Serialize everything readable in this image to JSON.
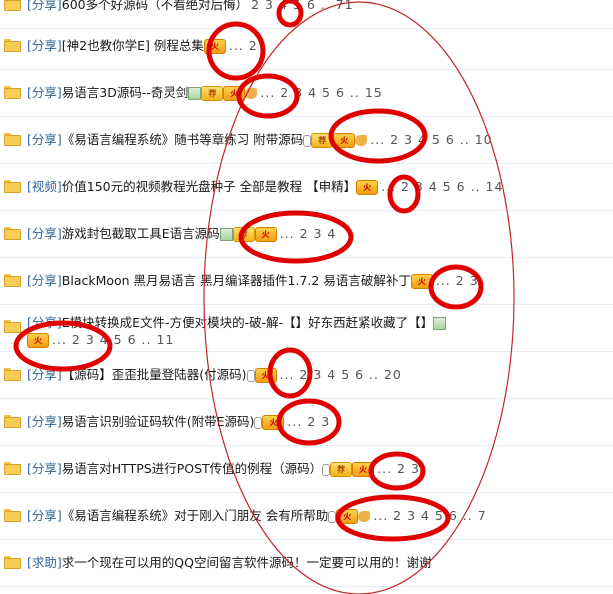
{
  "rows": [
    {
      "tag": "[分享]",
      "title": "600多个好源码（不看绝对后悔）",
      "icons": [],
      "pages": "2  3  4  5  6 .. 71"
    },
    {
      "tag": "[分享]",
      "title": "[神2也教你学E] 例程总集",
      "icons": [
        "fire"
      ],
      "pages": "... 2"
    },
    {
      "tag": "[分享]",
      "title": "易语言3D源码--奇灵剑",
      "icons": [
        "pic",
        "jian",
        "fire",
        "thumb"
      ],
      "pages": "... 2  3  4  5  6 .. 15"
    },
    {
      "tag": "[分享]",
      "title": "《易语言编程系统》随书等章练习 附带源码",
      "icons": [
        "clip",
        "jian",
        "fire",
        "thumb"
      ],
      "pages": "... 2  3  4  5  6 .. 10"
    },
    {
      "tag": "[视频]",
      "title": "价值150元的视频教程光盘种子 全部是教程 【申精】",
      "icons": [
        "fire"
      ],
      "pages": "... 2  3  4  5  6 .. 14"
    },
    {
      "tag": "[分享]",
      "title": "游戏封包截取工具E语言源码",
      "icons": [
        "pic",
        "jian",
        "fire"
      ],
      "pages": "... 2  3  4"
    },
    {
      "tag": "[分享]",
      "title": "BlackMoon 黑月易语言 黑月编译器插件1.7.2 易语言破解补丁",
      "icons": [
        "fire"
      ],
      "pages": "... 2  3"
    },
    {
      "tag": "[分享]",
      "title": "E模块转换成E文件-方便对模块的-破-解-【】好东西赶紧收藏了【】",
      "icons": [
        "pic"
      ],
      "line2": "... 2  3  4  5  6 .. 11",
      "icons2": [
        "fire"
      ]
    },
    {
      "tag": "[分享]",
      "title": "【源码】歪歪批量登陆器(付源码)",
      "icons": [
        "clip",
        "fire"
      ],
      "pages": "... 2  3  4  5  6 .. 20"
    },
    {
      "tag": "[分享]",
      "title": "易语言识别验证码软件(附带E源码)",
      "icons": [
        "clip",
        "fire"
      ],
      "pages": "... 2  3"
    },
    {
      "tag": "[分享]",
      "title": "易语言对HTTPS进行POST传值的例程（源码）",
      "icons": [
        "clip",
        "jian",
        "fire"
      ],
      "pages": "... 2  3"
    },
    {
      "tag": "[分享]",
      "title": "《易语言编程系统》对于刚入门朋友 会有所帮助",
      "icons": [
        "clip",
        "fire",
        "thumb"
      ],
      "pages": "... 2  3  4  5  6 .. 7"
    },
    {
      "tag": "[求助]",
      "title": "求一个现在可以用的QQ空间留言软件源码！一定要可以用的！谢谢",
      "icons": [],
      "pages": ""
    }
  ],
  "icon_labels": {
    "fire": "火",
    "jian": "荐"
  },
  "colors": {
    "tag": "#336699",
    "annotation": "#e00000",
    "ellipse": "#c0282a"
  }
}
